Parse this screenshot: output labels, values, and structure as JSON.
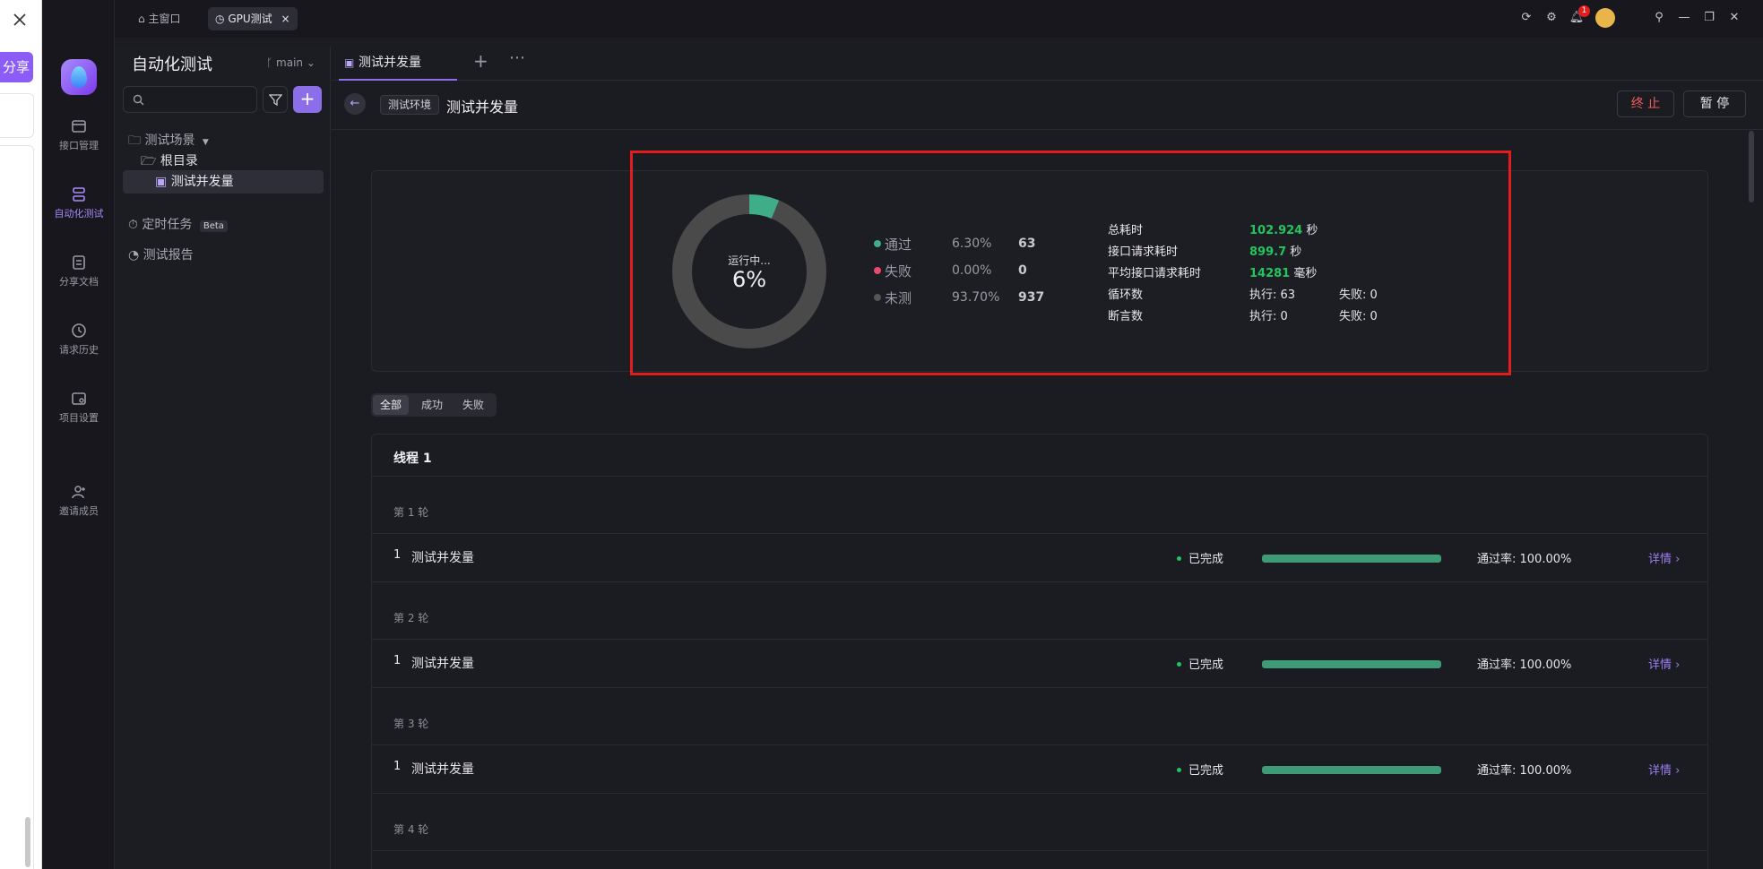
{
  "leftstrip": {
    "share_label": "分享"
  },
  "titlebar": {
    "tabs": [
      {
        "label": "主窗口"
      },
      {
        "label": "GPU测试"
      }
    ],
    "notification_count": "1"
  },
  "appnav": {
    "items": [
      {
        "label": "接口管理"
      },
      {
        "label": "自动化测试"
      },
      {
        "label": "分享文档"
      },
      {
        "label": "请求历史"
      },
      {
        "label": "项目设置"
      },
      {
        "label": "邀请成员"
      }
    ]
  },
  "tree": {
    "title": "自动化测试",
    "branch": "main",
    "search_placeholder": "",
    "nodes": {
      "scenes": "测试场景",
      "root": "根目录",
      "case": "测试并发量",
      "timed": "定时任务",
      "beta": "Beta",
      "report": "测试报告"
    }
  },
  "main": {
    "tab_label": "测试并发量",
    "env_tag": "测试环境",
    "title": "测试并发量",
    "stop_label": "终 止",
    "pause_label": "暂 停"
  },
  "summary": {
    "donut_status": "运行中...",
    "donut_pct": "6%",
    "pass_fraction": 0.063,
    "colors": {
      "pass": "#3fae88",
      "fail": "#e84a6f",
      "untested": "#4a4a4a"
    },
    "legend": [
      {
        "label": "通过",
        "pct": "6.30%",
        "count": "63"
      },
      {
        "label": "失败",
        "pct": "0.00%",
        "count": "0"
      },
      {
        "label": "未测",
        "pct": "93.70%",
        "count": "937"
      }
    ],
    "stats": {
      "total_time_label": "总耗时",
      "total_time_value": "102.924",
      "total_time_unit": "秒",
      "req_time_label": "接口请求耗时",
      "req_time_value": "899.7",
      "req_time_unit": "秒",
      "avg_time_label": "平均接口请求耗时",
      "avg_time_value": "14281",
      "avg_time_unit": "毫秒",
      "loop_label": "循环数",
      "loop_exec": "执行: 63",
      "loop_fail": "失败: 0",
      "assert_label": "断言数",
      "assert_exec": "执行: 0",
      "assert_fail": "失败: 0"
    }
  },
  "filters": {
    "all": "全部",
    "success": "成功",
    "fail": "失败"
  },
  "results": {
    "thread_label": "线程 1",
    "rounds": [
      {
        "label": "第 1 轮",
        "idx": "1",
        "name": "测试并发量",
        "status": "已完成",
        "progress": 1.0,
        "rate": "通过率: 100.00%",
        "detail": "详情 ›"
      },
      {
        "label": "第 2 轮",
        "idx": "1",
        "name": "测试并发量",
        "status": "已完成",
        "progress": 1.0,
        "rate": "通过率: 100.00%",
        "detail": "详情 ›"
      },
      {
        "label": "第 3 轮",
        "idx": "1",
        "name": "测试并发量",
        "status": "已完成",
        "progress": 1.0,
        "rate": "通过率: 100.00%",
        "detail": "详情 ›"
      },
      {
        "label": "第 4 轮"
      }
    ]
  }
}
